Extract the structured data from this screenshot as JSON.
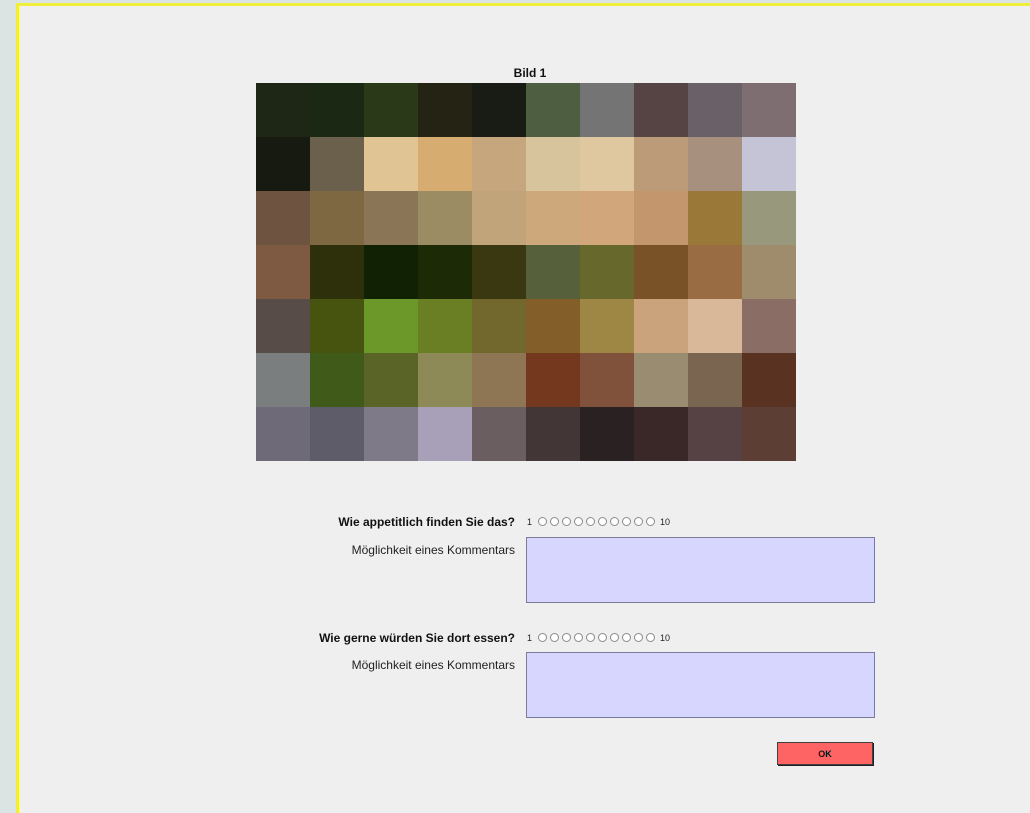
{
  "title": "Bild 1",
  "mosaic_colors": [
    [
      "#1e2616",
      "#1a2814",
      "#2a3a18",
      "#252414",
      "#181c14",
      "#4e5e40",
      "#747474",
      "#564444",
      "#6a6168",
      "#7e6e72"
    ],
    [
      "#171a10",
      "#6a604c",
      "#e0c494",
      "#d6ac70",
      "#c6a67c",
      "#d8c49c",
      "#dfc8a0",
      "#bc9c78",
      "#a8907e",
      "#c4c4d6"
    ],
    [
      "#6e5440",
      "#7e6842",
      "#8a7656",
      "#9c8c64",
      "#c2a47a",
      "#cca87a",
      "#d0a67a",
      "#c4966e",
      "#9a7838",
      "#98987c"
    ],
    [
      "#7e5a42",
      "#2e300c",
      "#112204",
      "#1c2a06",
      "#3a3810",
      "#56603a",
      "#66682c",
      "#7a5228",
      "#9a6c44",
      "#9e8c6c"
    ],
    [
      "#584c48",
      "#465410",
      "#6c982a",
      "#6a7e24",
      "#72682e",
      "#845e28",
      "#9e8644",
      "#caa27c",
      "#d8b898",
      "#8a6e66"
    ],
    [
      "#7a7e7e",
      "#405a1a",
      "#5a6426",
      "#8e8a58",
      "#8e7654",
      "#74381e",
      "#80523c",
      "#9a8c70",
      "#7a6650",
      "#5a3222"
    ],
    [
      "#6e6a78",
      "#5e5c68",
      "#7e7a88",
      "#a8a0b8",
      "#6a5e60",
      "#423636",
      "#2a2222",
      "#3a2828",
      "#564244",
      "#5c3e34"
    ]
  ],
  "questions": [
    {
      "text": "Wie appetitlich finden Sie das?",
      "scale_min": "1",
      "scale_max": "10",
      "comment_label": "Möglichkeit eines Kommentars",
      "comment_value": ""
    },
    {
      "text": "Wie gerne würden Sie dort essen?",
      "scale_min": "1",
      "scale_max": "10",
      "comment_label": "Möglichkeit eines Kommentars",
      "comment_value": ""
    }
  ],
  "ok_label": "OK",
  "colors": {
    "frame_border": "#f0ee3a",
    "comment_bg": "#d6d6ff",
    "ok_bg": "#ff6464"
  }
}
